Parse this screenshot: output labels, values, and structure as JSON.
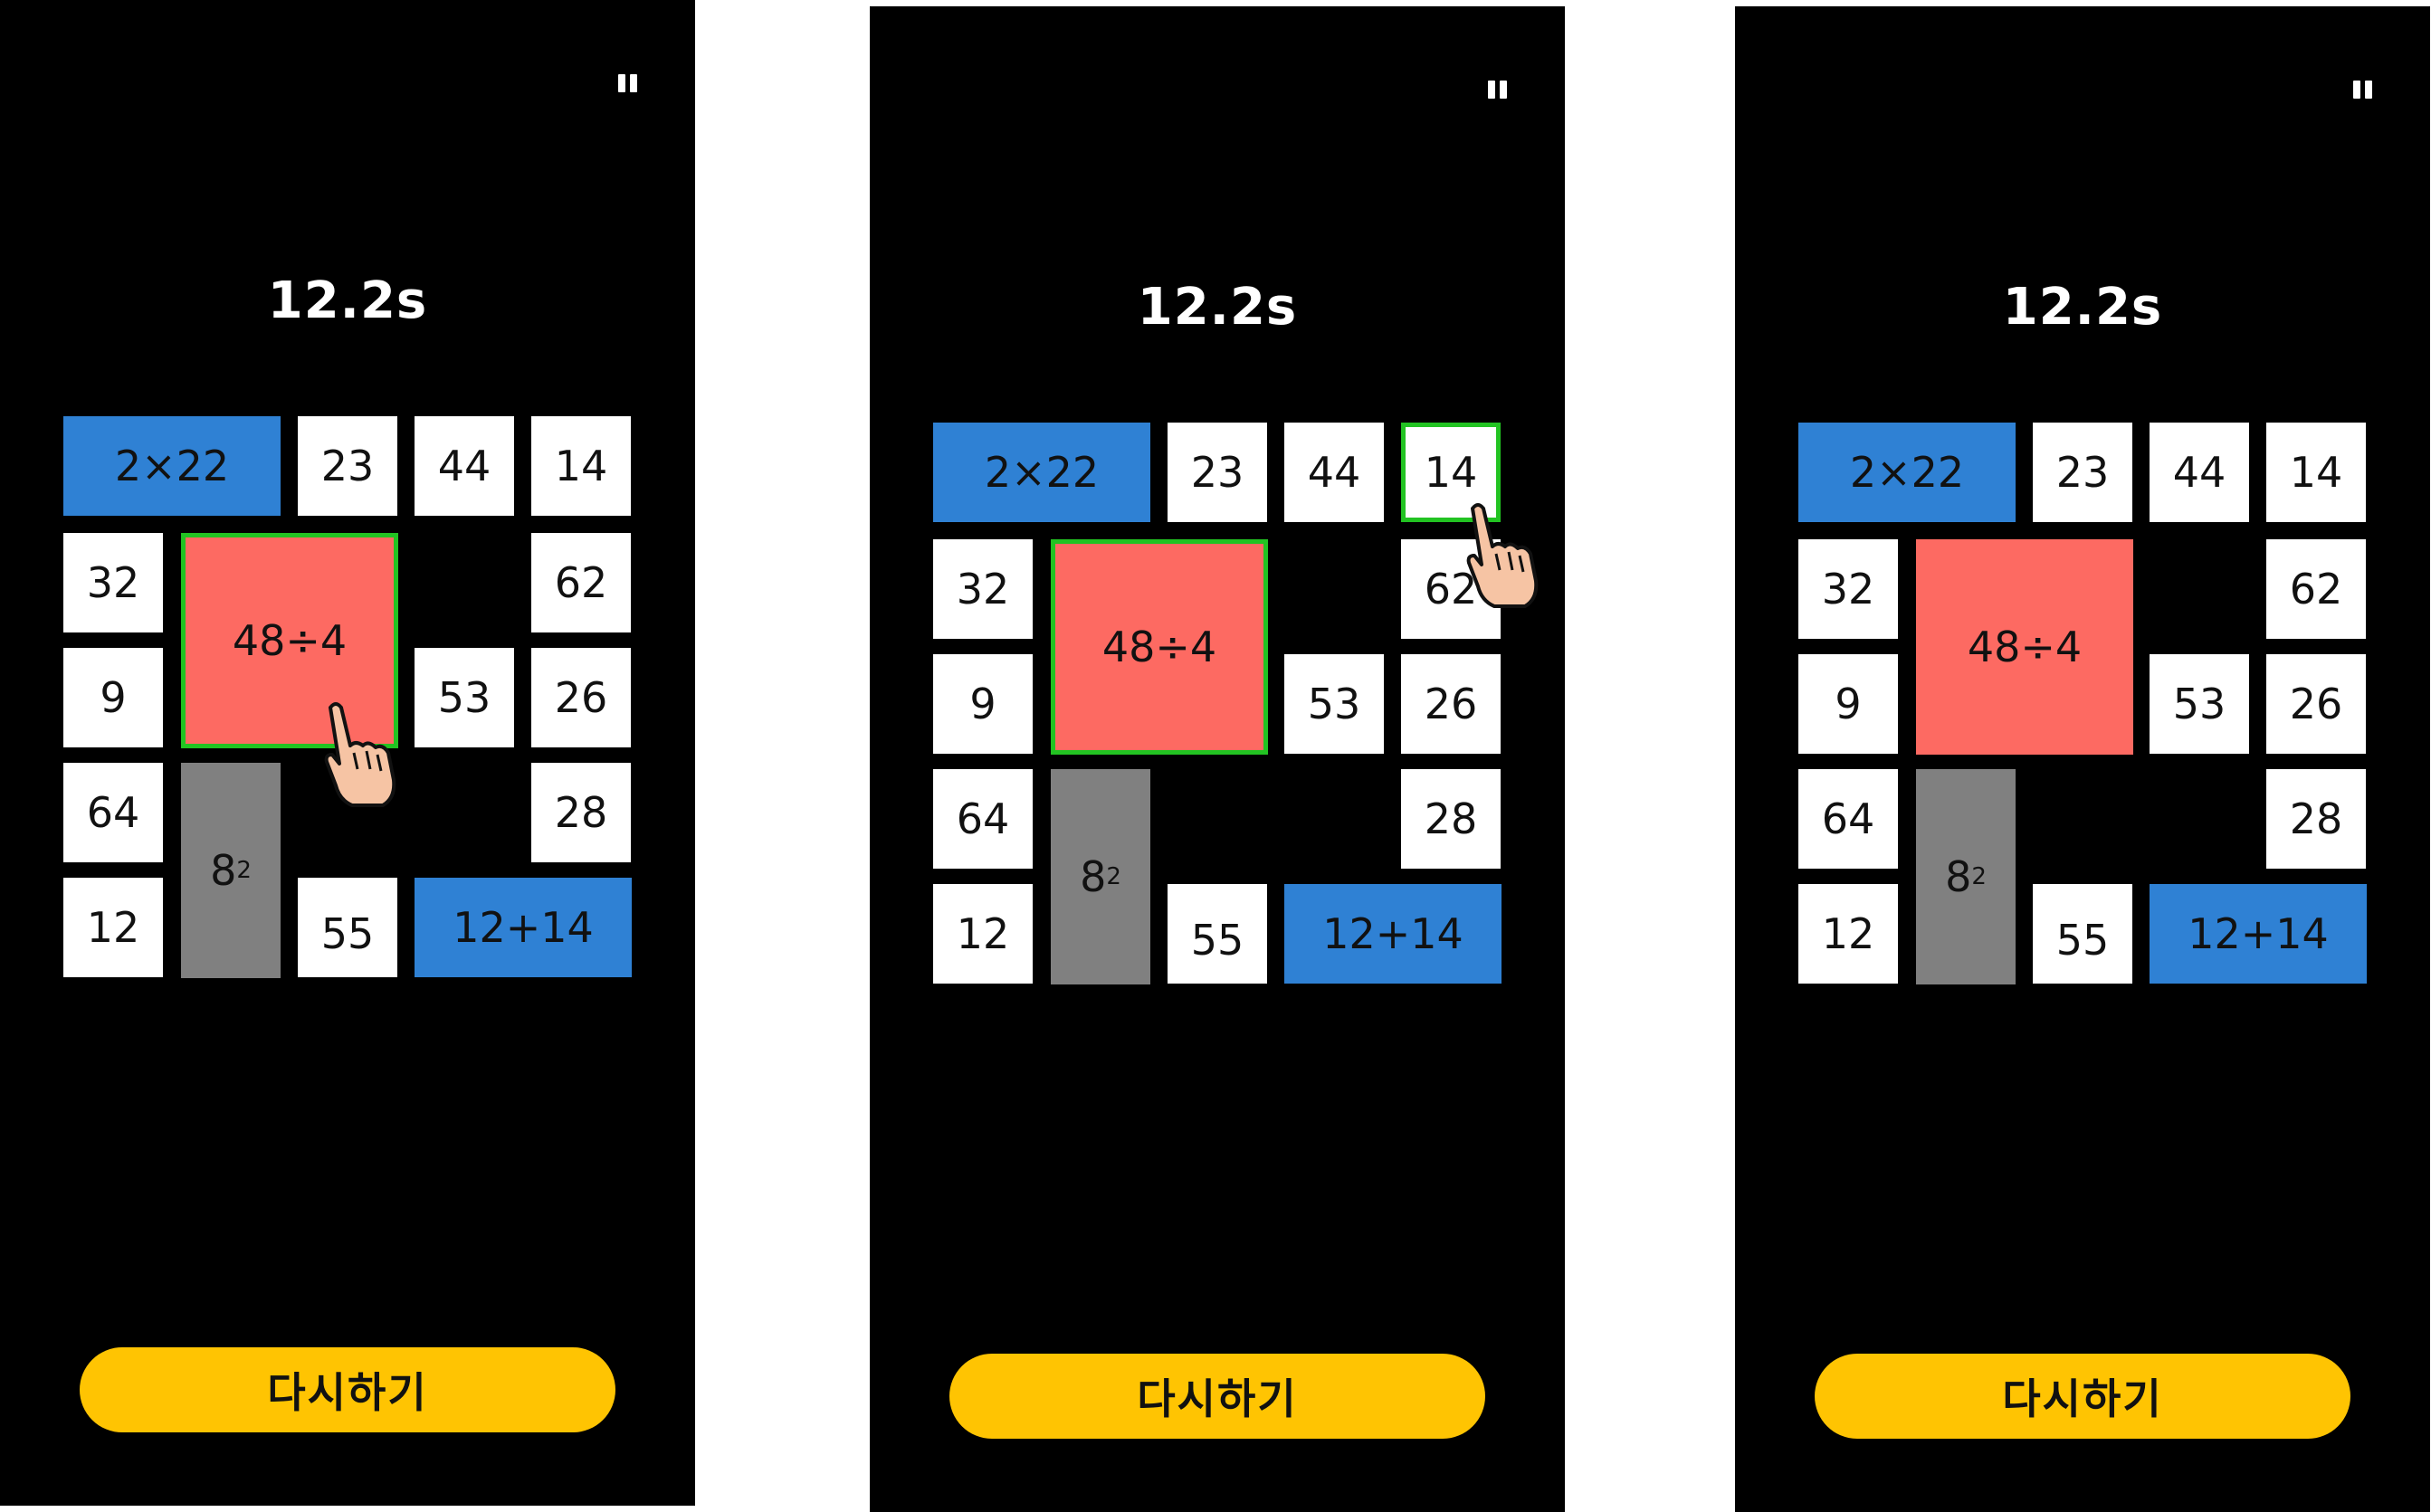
{
  "colors": {
    "background": "#000000",
    "tile": "#ffffff",
    "blue_tile": "#2f81d4",
    "red_tile": "#fd6a62",
    "gray_tile": "#808080",
    "selected_border": "#22c322",
    "button": "#ffc402"
  },
  "screens": [
    {
      "pause_icon": "pause-icon",
      "timer": "12.2s",
      "tiles": {
        "t_2x22": "2×22",
        "t_23": "23",
        "t_44": "44",
        "t_14": "14",
        "t_32": "32",
        "t_48d4": "48÷4",
        "t_62": "62",
        "t_9": "9",
        "t_53": "53",
        "t_26": "26",
        "t_64": "64",
        "t_8sq_base": "8",
        "t_8sq_exp": "2",
        "t_28": "28",
        "t_12": "12",
        "t_55": "55",
        "t_12p14": "12+14"
      },
      "selected": [
        "t_48d4"
      ],
      "pointer": "hand-pointer-icon",
      "retry_label": "다시하기"
    },
    {
      "pause_icon": "pause-icon",
      "timer": "12.2s",
      "tiles": {
        "t_2x22": "2×22",
        "t_23": "23",
        "t_44": "44",
        "t_14": "14",
        "t_32": "32",
        "t_48d4": "48÷4",
        "t_62": "62",
        "t_9": "9",
        "t_53": "53",
        "t_26": "26",
        "t_64": "64",
        "t_8sq_base": "8",
        "t_8sq_exp": "2",
        "t_28": "28",
        "t_12": "12",
        "t_55": "55",
        "t_12p14": "12+14"
      },
      "selected": [
        "t_48d4",
        "t_14"
      ],
      "pointer": "hand-pointer-icon",
      "retry_label": "다시하기"
    },
    {
      "pause_icon": "pause-icon",
      "timer": "12.2s",
      "tiles": {
        "t_2x22": "2×22",
        "t_23": "23",
        "t_44": "44",
        "t_14": "14",
        "t_32": "32",
        "t_48d4": "48÷4",
        "t_62": "62",
        "t_9": "9",
        "t_53": "53",
        "t_26": "26",
        "t_64": "64",
        "t_8sq_base": "8",
        "t_8sq_exp": "2",
        "t_28": "28",
        "t_12": "12",
        "t_55": "55",
        "t_12p14": "12+14"
      },
      "selected": [],
      "retry_label": "다시하기"
    }
  ]
}
